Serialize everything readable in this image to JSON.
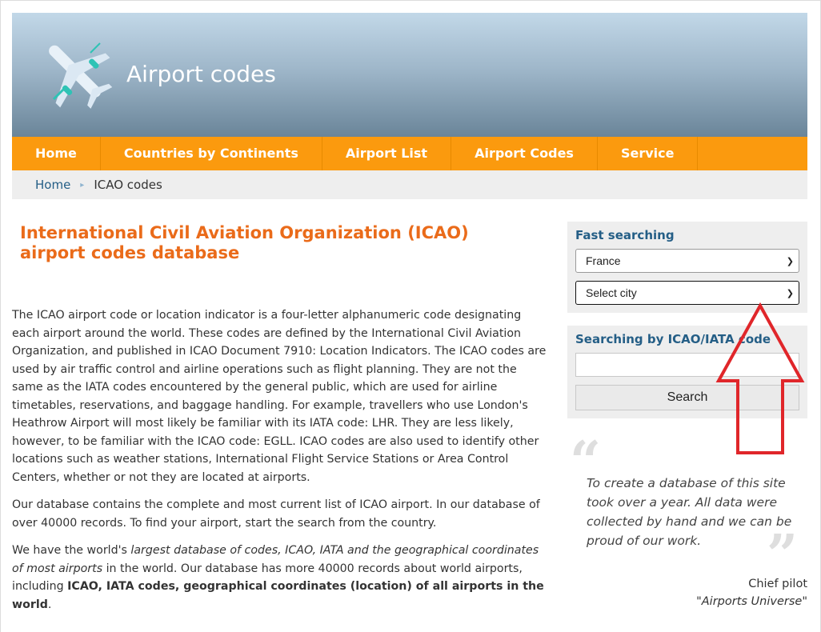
{
  "site": {
    "title": "Airport codes"
  },
  "nav": {
    "items": [
      {
        "label": "Home"
      },
      {
        "label": "Countries by Continents"
      },
      {
        "label": "Airport List"
      },
      {
        "label": "Airport Codes"
      },
      {
        "label": "Service"
      }
    ]
  },
  "breadcrumb": {
    "home": "Home",
    "current": "ICAO codes"
  },
  "main": {
    "title": "International Civil Aviation Organization (ICAO) airport codes database",
    "paragraph1": "The ICAO airport code or location indicator is a four-letter alphanumeric code designating each airport around the world. These codes are defined by the International Civil Aviation Organization, and published in ICAO Document 7910: Location Indicators. The ICAO codes are used by air traffic control and airline operations such as flight planning. They are not the same as the IATA codes encountered by the general public, which are used for airline timetables, reservations, and baggage handling. For example, travellers who use London's Heathrow Airport will most likely be familiar with its IATA code: LHR. They are less likely, however, to be familiar with the ICAO code: EGLL. ICAO codes are also used to identify other locations such as weather stations, International Flight Service Stations or Area Control Centers, whether or not they are located at airports.",
    "paragraph2": "Our database contains the complete and most current list of ICAO airport. In our database of over 40000 records. To find your airport, start the search from the country.",
    "paragraph3": {
      "part1": "We have the world's ",
      "italic": "largest database of codes, ICAO, IATA and the geographical coordinates of most airports",
      "part2": " in the world. Our database has more 40000 records about world airports, including ",
      "bold": "ICAO, IATA codes, geographical coordinates (location) of all airports in the world",
      "part3": "."
    }
  },
  "sidebar": {
    "fast_search": {
      "title": "Fast searching",
      "country_value": "France",
      "city_value": "Select city"
    },
    "code_search": {
      "title": "Searching by ICAO/IATA code",
      "input_value": "",
      "button_label": "Search"
    },
    "quote": {
      "open_mark": "“",
      "close_mark": "”",
      "text": "To create a database of this site took over a year. All data were collected by hand and we can be proud of our work.",
      "author": "Chief pilot",
      "organization": "\"Airports Universe\""
    }
  },
  "icons": {
    "logo": "airplane-icon",
    "breadcrumb_separator": "chevron-right-icon",
    "select_chevron": "chevron-down-icon",
    "annotation": "up-arrow-icon"
  },
  "colors": {
    "nav": "#fb9a0e",
    "title": "#ea6b1a",
    "link": "#245e86",
    "annotation": "#e0262a"
  }
}
